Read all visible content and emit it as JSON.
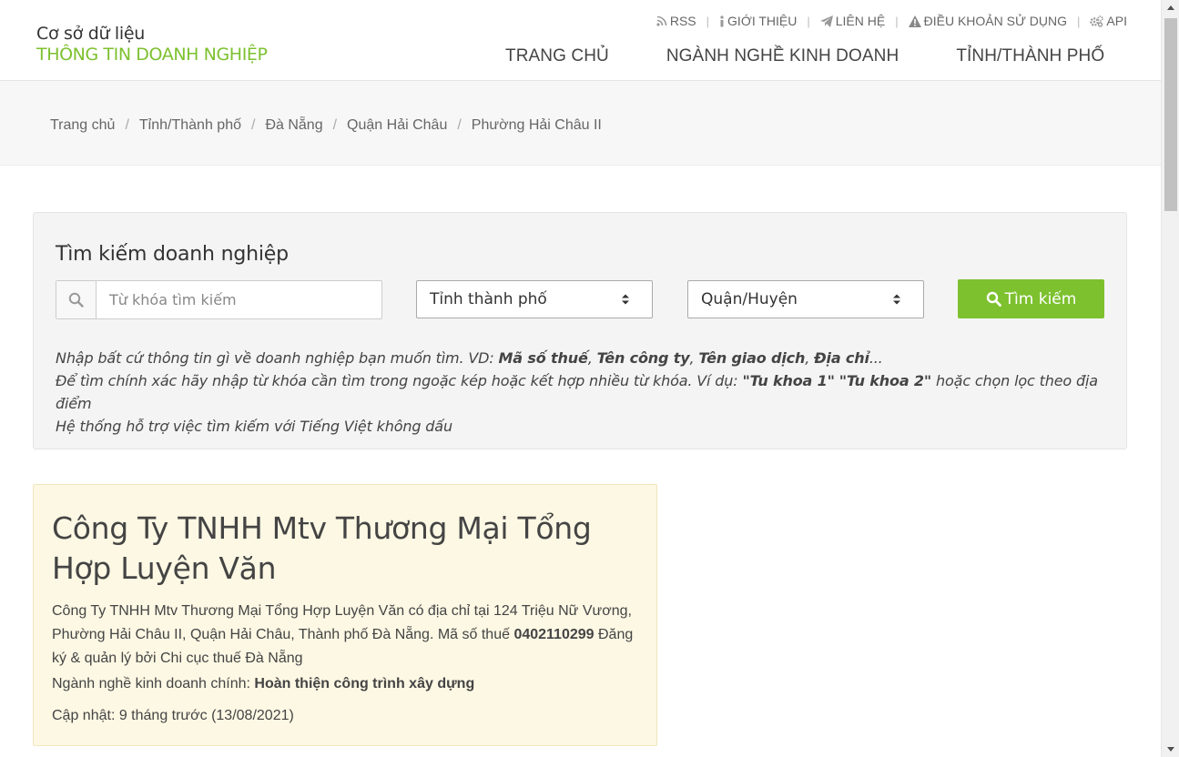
{
  "logo": {
    "line1": "Cơ sở dữ liệu",
    "line2": "THÔNG TIN DOANH NGHIỆP"
  },
  "toplinks": [
    {
      "label": "RSS",
      "icon": "rss-icon"
    },
    {
      "label": "GIỚI THIỆU",
      "icon": "info-icon"
    },
    {
      "label": "LIÊN HỆ",
      "icon": "paper-plane-icon"
    },
    {
      "label": "ĐIỀU KHOẢN SỬ DỤNG",
      "icon": "warning-icon"
    },
    {
      "label": "API",
      "icon": "gears-icon"
    }
  ],
  "nav": [
    "TRANG CHỦ",
    "NGÀNH NGHỀ KINH DOANH",
    "TỈNH/THÀNH PHỐ"
  ],
  "breadcrumb": [
    "Trang chủ",
    "Tỉnh/Thành phố",
    "Đà Nẵng",
    "Quận Hải Châu",
    "Phường Hải Châu II"
  ],
  "search": {
    "title": "Tìm kiếm doanh nghiệp",
    "placeholder": "Từ khóa tìm kiếm",
    "province": "Tỉnh thành phố",
    "district": "Quận/Huyện",
    "button": "Tìm kiếm",
    "hint1_a": "Nhập bất cứ thông tin gì về doanh nghiệp bạn muốn tìm. VD: ",
    "hint1_b1": "Mã số thuế",
    "hint1_c1": ", ",
    "hint1_b2": "Tên công ty",
    "hint1_c2": ", ",
    "hint1_b3": "Tên giao dịch",
    "hint1_c3": ", ",
    "hint1_b4": "Địa chỉ",
    "hint1_d": "...",
    "hint2_a": "Để tìm chính xác hãy nhập từ khóa cần tìm trong ngoặc kép hoặc kết hợp nhiều từ khóa. Ví dụ: ",
    "hint2_b1": "\"Tu khoa 1\"",
    "hint2_sp": " ",
    "hint2_b2": "\"Tu khoa 2\"",
    "hint2_c": " hoặc chọn lọc theo địa điểm",
    "hint3": "Hệ thống hỗ trợ việc tìm kiếm với Tiếng Việt không dấu"
  },
  "company": {
    "name": "Công Ty TNHH Mtv Thương Mại Tổng Hợp Luyện Văn",
    "desc_a": "Công Ty TNHH Mtv Thương Mại Tổng Hợp Luyện Văn có địa chỉ tại 124 Triệu Nữ Vương, Phường Hải Châu II, Quận Hải Châu, Thành phố Đà Nẵng. Mã số thuế ",
    "tax_id": "0402110299",
    "desc_b": " Đăng ký & quản lý bởi Chi cục thuế Đà Nẵng",
    "industry_label": "Ngành nghề kinh doanh chính: ",
    "industry": "Hoàn thiện công trình xây dựng",
    "updated": "Cập nhật: 9 tháng trước (13/08/2021)"
  },
  "colors": {
    "brand_green": "#7dc12f",
    "card_bg": "#fdf8e4"
  }
}
